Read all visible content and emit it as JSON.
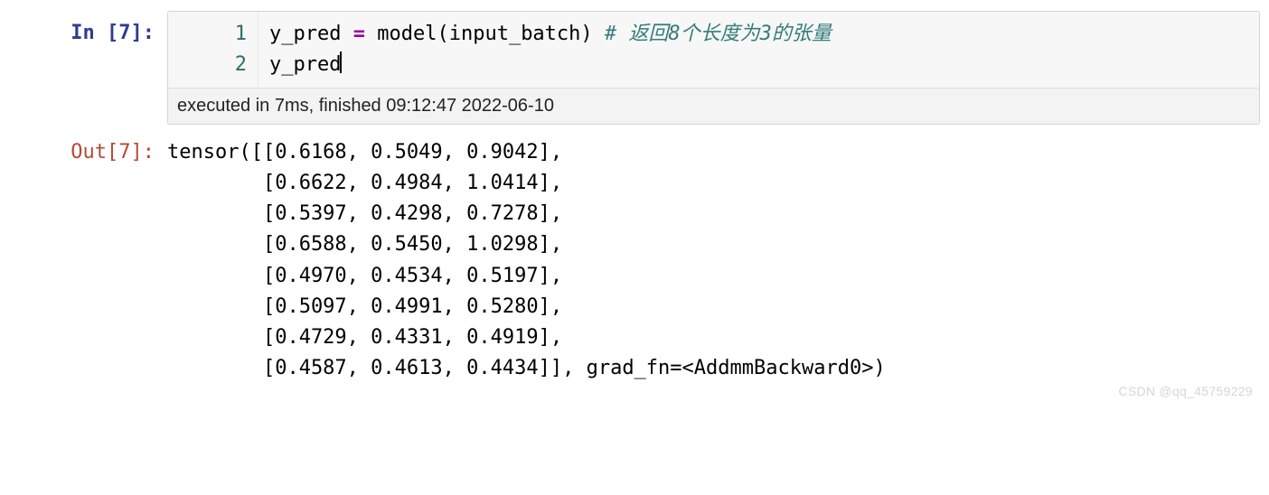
{
  "prompt": {
    "in": "In [7]:",
    "out": "Out[7]:"
  },
  "gutter": [
    "1",
    "2"
  ],
  "code": {
    "l1": {
      "v1": "y_pred",
      "op": " = ",
      "call": "model",
      "lp": "(",
      "arg": "input_batch",
      "rp": ") ",
      "comment": "# 返回8个长度为3的张量"
    },
    "l2": {
      "v1": "y_pred"
    }
  },
  "status": "executed in 7ms, finished 09:12:47 2022-06-10",
  "output": "tensor([[0.6168, 0.5049, 0.9042],\n        [0.6622, 0.4984, 1.0414],\n        [0.5397, 0.4298, 0.7278],\n        [0.6588, 0.5450, 1.0298],\n        [0.4970, 0.4534, 0.5197],\n        [0.5097, 0.4991, 0.5280],\n        [0.4729, 0.4331, 0.4919],\n        [0.4587, 0.4613, 0.4434]], grad_fn=<AddmmBackward0>)",
  "watermark": "CSDN @qq_45759229"
}
